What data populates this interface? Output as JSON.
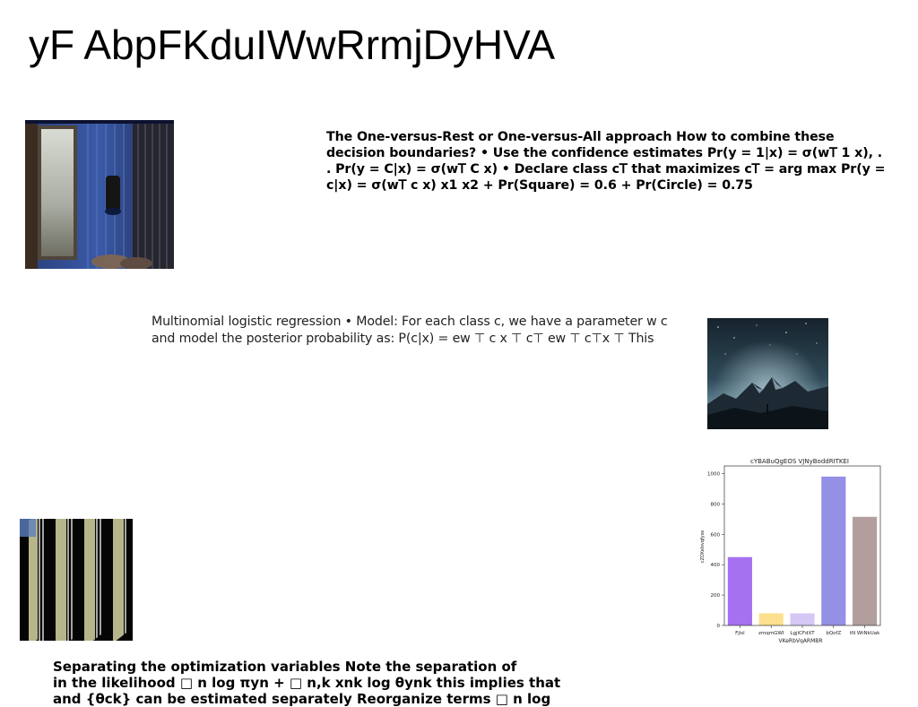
{
  "title": "yF AbpFKduIWwRrmjDyHVA",
  "text_block_1": "The One-versus-Rest or One-versus-All approach How to combine these decision boundaries? • Use the confidence estimates Pr(y = 1|x) = σ(w𝖳 1 x), . . Pr(y = C|x) = σ(w𝖳 C x) • Declare class c𝖳 that maximizes c𝖳 = arg max Pr(y = c|x) = σ(w𝖳 c x) x1 x2 + Pr(Square) = 0.6 + Pr(Circle) = 0.75",
  "text_block_2": "Multinomial logistic regression • Model: For each class c, we have a parameter w c and model the posterior probability as: P(c|x) = ew ⊤ c x ⊤ c⊤ ew ⊤ c⊤x ⊤ This",
  "text_block_3": "Separating the optimization variables Note the separation of\nin the likelihood □ n log πyn + □ n,k xnk log θynk this implies that\nand {θck} can be estimated separately Reorganize terms □ n log",
  "chart_data": {
    "type": "bar",
    "title": "cYBABuQgEOS VJNyBoddRITKEI",
    "xlabel": "VKeRbVqARMBR",
    "ylabel": "cZOXeIsvqfyse",
    "categories": [
      "Fjisl",
      "zmqmGWI",
      "LgjiCFdXT",
      "bQofZ",
      "tN WtNkUak"
    ],
    "values": [
      450,
      80,
      80,
      980,
      715
    ],
    "colors": [
      "#a571f0",
      "#fde08f",
      "#d6c8f5",
      "#9490e6",
      "#b29e9c"
    ],
    "ylim": [
      0,
      1050
    ],
    "yticks": [
      0,
      200,
      400,
      600,
      800,
      1000
    ],
    "grid": false
  }
}
